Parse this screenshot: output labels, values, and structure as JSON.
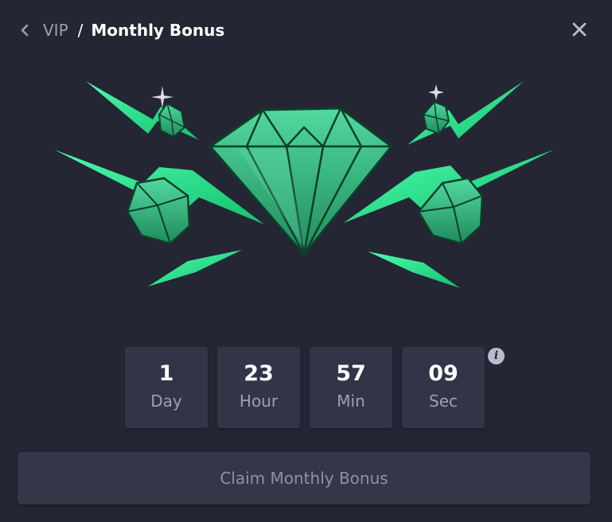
{
  "header": {
    "back_icon": "chevron-left-icon",
    "parent_crumb": "VIP",
    "separator": "/",
    "title": "Monthly Bonus",
    "close_icon": "close-icon"
  },
  "hero": {
    "illustration": "green-gems-illustration",
    "accent_color": "#1fd97f"
  },
  "countdown": {
    "days": {
      "value": "1",
      "unit": "Day"
    },
    "hours": {
      "value": "23",
      "unit": "Hour"
    },
    "minutes": {
      "value": "57",
      "unit": "Min"
    },
    "seconds": {
      "value": "09",
      "unit": "Sec"
    },
    "info_icon": "info-icon",
    "info_glyph": "i"
  },
  "claim_button": {
    "label": "Claim Monthly Bonus"
  },
  "colors": {
    "background": "#242634",
    "panel": "#323547",
    "muted_text": "#9ba0b4",
    "button": "#343748"
  }
}
